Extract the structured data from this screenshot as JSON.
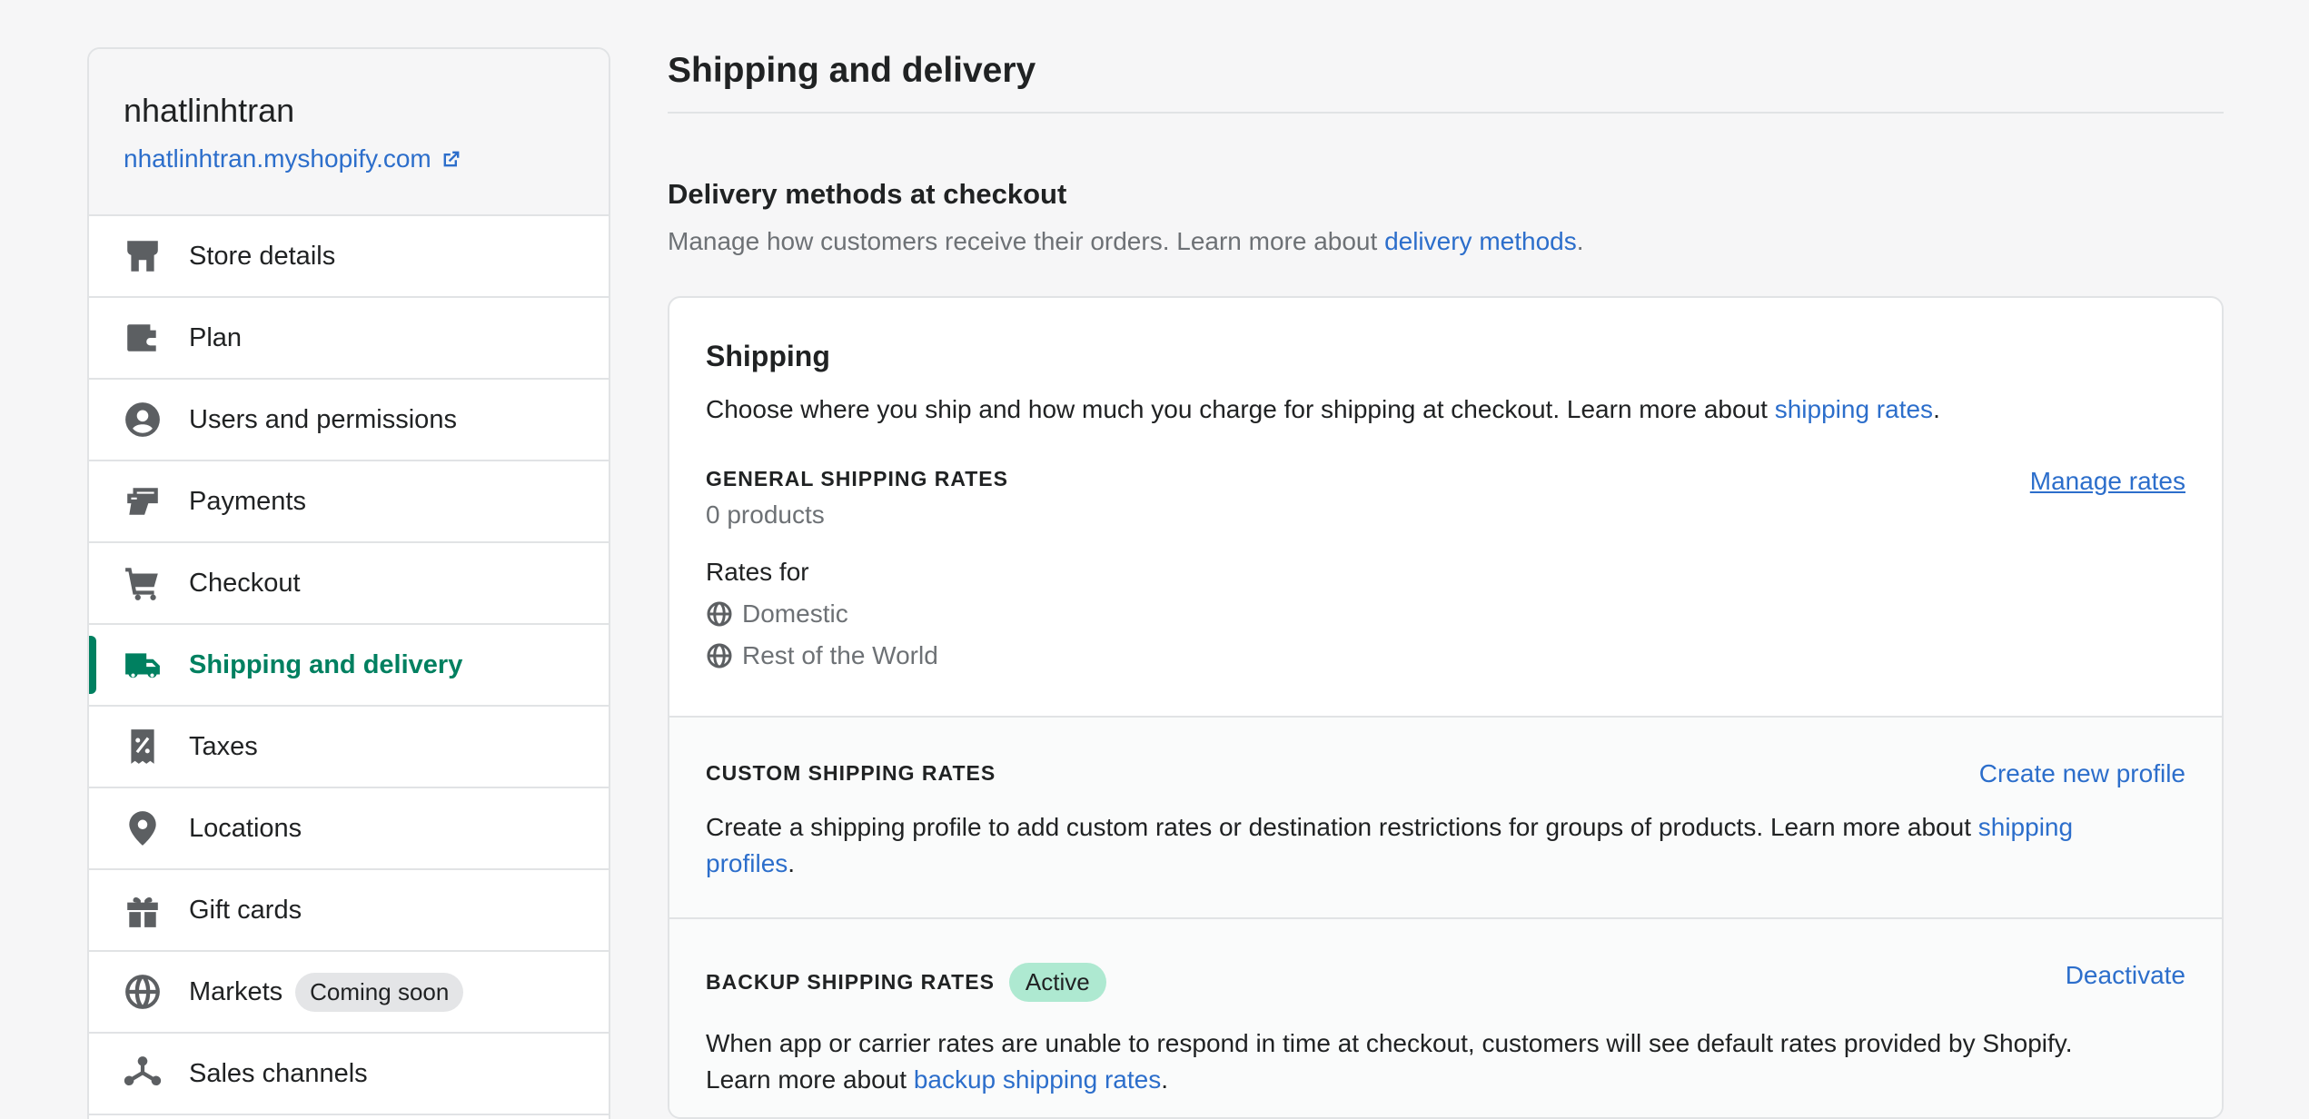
{
  "store": {
    "name": "nhatlinhtran",
    "url": "nhatlinhtran.myshopify.com"
  },
  "sidebar": {
    "items": [
      {
        "label": "Store details",
        "icon": "store-icon"
      },
      {
        "label": "Plan",
        "icon": "wallet-icon"
      },
      {
        "label": "Users and permissions",
        "icon": "user-circle-icon"
      },
      {
        "label": "Payments",
        "icon": "payments-icon"
      },
      {
        "label": "Checkout",
        "icon": "cart-icon"
      },
      {
        "label": "Shipping and delivery",
        "icon": "truck-icon",
        "active": true
      },
      {
        "label": "Taxes",
        "icon": "tax-receipt-icon"
      },
      {
        "label": "Locations",
        "icon": "location-pin-icon"
      },
      {
        "label": "Gift cards",
        "icon": "gift-icon"
      },
      {
        "label": "Markets",
        "icon": "globe-icon",
        "badge": "Coming soon"
      },
      {
        "label": "Sales channels",
        "icon": "channels-icon"
      }
    ]
  },
  "page": {
    "title": "Shipping and delivery",
    "section_title": "Delivery methods at checkout",
    "section_desc_prefix": "Manage how customers receive their orders. Learn more about ",
    "section_desc_link": "delivery methods",
    "section_desc_suffix": "."
  },
  "shipping": {
    "heading": "Shipping",
    "desc_prefix": "Choose where you ship and how much you charge for shipping at checkout. Learn more about ",
    "desc_link": "shipping rates",
    "desc_suffix": ".",
    "general": {
      "title": "GENERAL SHIPPING RATES",
      "count": "0 products",
      "action": "Manage rates",
      "rates_for": "Rates for",
      "zones": [
        "Domestic",
        "Rest of the World"
      ]
    },
    "custom": {
      "title": "CUSTOM SHIPPING RATES",
      "action": "Create new profile",
      "text_prefix": "Create a shipping profile to add custom rates or destination restrictions for groups of products. Learn more about ",
      "text_link": "shipping profiles",
      "text_suffix": "."
    },
    "backup": {
      "title": "BACKUP SHIPPING RATES",
      "badge": "Active",
      "action": "Deactivate",
      "text_prefix": "When app or carrier rates are unable to respond in time at checkout, customers will see default rates provided by Shopify. Learn more about ",
      "text_link": "backup shipping rates",
      "text_suffix": "."
    }
  },
  "colors": {
    "accent": "#008060",
    "link": "#2c6ecb",
    "active_badge": "#aee9d1"
  }
}
